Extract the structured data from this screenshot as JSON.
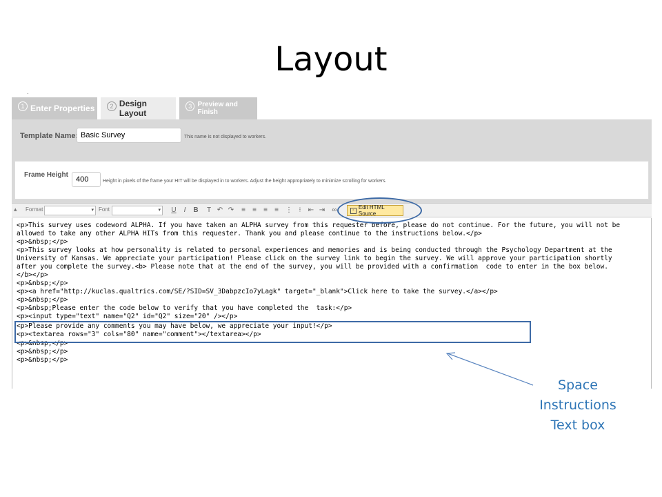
{
  "slide": {
    "title": "Layout"
  },
  "screenshot": {
    "tabs": [
      {
        "number": "1",
        "label": "Enter Properties"
      },
      {
        "number": "2",
        "label": "Design Layout"
      },
      {
        "number": "3",
        "label": "Preview and Finish"
      }
    ],
    "template_name": {
      "label": "Template Name:",
      "value": "Basic Survey",
      "hint": "This name is not displayed to workers."
    },
    "frame_height": {
      "label": "Frame Height",
      "value": "400",
      "hint": "Height in pixels of the frame your HIT will be displayed in to workers. Adjust the height appropriately to minimize scrolling for workers."
    },
    "toolbar": {
      "format_label": "Format",
      "font_label": "Font",
      "buttons": [
        "U",
        "I",
        "B"
      ],
      "edit_html_source": "Edit HTML Source"
    },
    "code_lines": [
      "<p>This survey uses codeword ALPHA. If you have taken an ALPHA survey from this requester before, please do not continue. For the future, you will not be",
      "allowed to take any other ALPHA HITs from this requester. Thank you and please continue to the instructions below.</p>",
      "<p>&nbsp;</p>",
      "<p>This survey looks at how personality is related to personal experiences and memories and is being conducted through the Psychology Department at the",
      "University of Kansas. We appreciate your participation! Please click on the survey link to begin the survey. We will approve your participation shortly",
      "after you complete the survey.<b> Please note that at the end of the survey, you will be provided with a confirmation  code to enter in the box below.",
      "</b></p>",
      "<p>&nbsp;</p>",
      "<p><a href=\"http://kuclas.qualtrics.com/SE/?SID=SV_3DabpzcIo7yLagk\" target=\"_blank\">Click here to take the survey.</a></p>",
      "<p>&nbsp;</p>",
      "<p>&nbsp;Please enter the code below to verify that you have completed the  task:</p>",
      "<p><input type=\"text\" name=\"Q2\" id=\"Q2\" size=\"20\" /></p>",
      "<p>Please provide any comments you may have below, we appreciate your input!</p>",
      "<p><textarea rows=\"3\" cols=\"80\" name=\"comment\"></textarea></p>",
      "<p>&nbsp;</p>",
      "<p>&nbsp;</p>",
      "<p>&nbsp;</p>"
    ]
  },
  "annotation": {
    "line1": "Space",
    "line2": "Instructions",
    "line3": "Text box",
    "color": "#2e75b6"
  }
}
